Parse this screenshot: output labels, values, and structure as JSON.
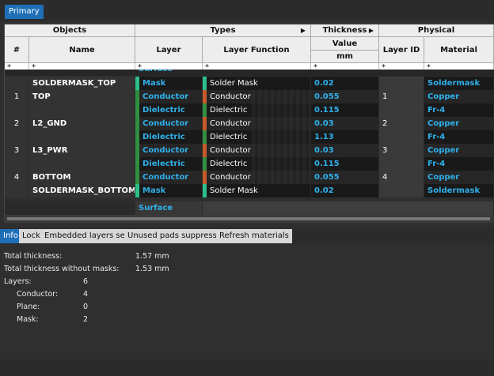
{
  "tabs": {
    "primary": "Primary"
  },
  "headers": {
    "objects": "Objects",
    "types": "Types",
    "thickness": "Thickness",
    "physical": "Physical",
    "num": "#",
    "name": "Name",
    "layer": "Layer",
    "layer_function": "Layer Function",
    "value": "Value",
    "unit": "mm",
    "layer_id": "Layer ID",
    "material": "Material"
  },
  "filter": "*",
  "rows": [
    {
      "num": "",
      "name": "SOLDERMASK_TOP",
      "layer": "Mask",
      "layer_color": "#2bbf89",
      "function": "Solder Mask",
      "function_color": "#2bbf89",
      "thickness": "0.02",
      "layer_id": "",
      "material": "Soldermask"
    },
    {
      "num": "1",
      "name": "TOP",
      "layer": "Conductor",
      "layer_color": "#2f8f3f",
      "function": "Conductor",
      "function_color": "#c65a2a",
      "thickness": "0.055",
      "layer_id": "1",
      "material": "Copper"
    },
    {
      "num": "",
      "name": "",
      "layer": "Dielectric",
      "layer_color": "#2f8f3f",
      "function": "Dielectric",
      "function_color": "#2f8f3f",
      "thickness": "0.115",
      "layer_id": "",
      "material": "Fr-4"
    },
    {
      "num": "2",
      "name": "L2_GND",
      "layer": "Conductor",
      "layer_color": "#2f8f3f",
      "function": "Conductor",
      "function_color": "#c65a2a",
      "thickness": "0.03",
      "layer_id": "2",
      "material": "Copper"
    },
    {
      "num": "",
      "name": "",
      "layer": "Dielectric",
      "layer_color": "#2f8f3f",
      "function": "Dielectric",
      "function_color": "#2f8f3f",
      "thickness": "1.13",
      "layer_id": "",
      "material": "Fr-4"
    },
    {
      "num": "3",
      "name": "L3_PWR",
      "layer": "Conductor",
      "layer_color": "#2f8f3f",
      "function": "Conductor",
      "function_color": "#c65a2a",
      "thickness": "0.03",
      "layer_id": "3",
      "material": "Copper"
    },
    {
      "num": "",
      "name": "",
      "layer": "Dielectric",
      "layer_color": "#2f8f3f",
      "function": "Dielectric",
      "function_color": "#2f8f3f",
      "thickness": "0.115",
      "layer_id": "",
      "material": "Fr-4"
    },
    {
      "num": "4",
      "name": "BOTTOM",
      "layer": "Conductor",
      "layer_color": "#2f8f3f",
      "function": "Conductor",
      "function_color": "#c65a2a",
      "thickness": "0.055",
      "layer_id": "4",
      "material": "Copper"
    },
    {
      "num": "",
      "name": "SOLDERMASK_BOTTOM",
      "layer": "Mask",
      "layer_color": "#2bbf89",
      "function": "Solder Mask",
      "function_color": "#2bbf89",
      "thickness": "0.02",
      "layer_id": "",
      "material": "Soldermask"
    }
  ],
  "surface_label": "Surface",
  "buttons": [
    "Info",
    "Lock",
    "Embedded layers setup",
    "Unused pads suppression",
    "Refresh materials"
  ],
  "info": {
    "total_thickness_label": "Total thickness:",
    "total_thickness": "1.57 mm",
    "without_masks_label": "Total thickness without masks:",
    "without_masks": "1.53 mm",
    "layers_label": "Layers:",
    "layers": "6",
    "conductor_label": "Conductor:",
    "conductor": "4",
    "plane_label": "Plane:",
    "plane": "0",
    "mask_label": "Mask:",
    "mask": "2"
  }
}
